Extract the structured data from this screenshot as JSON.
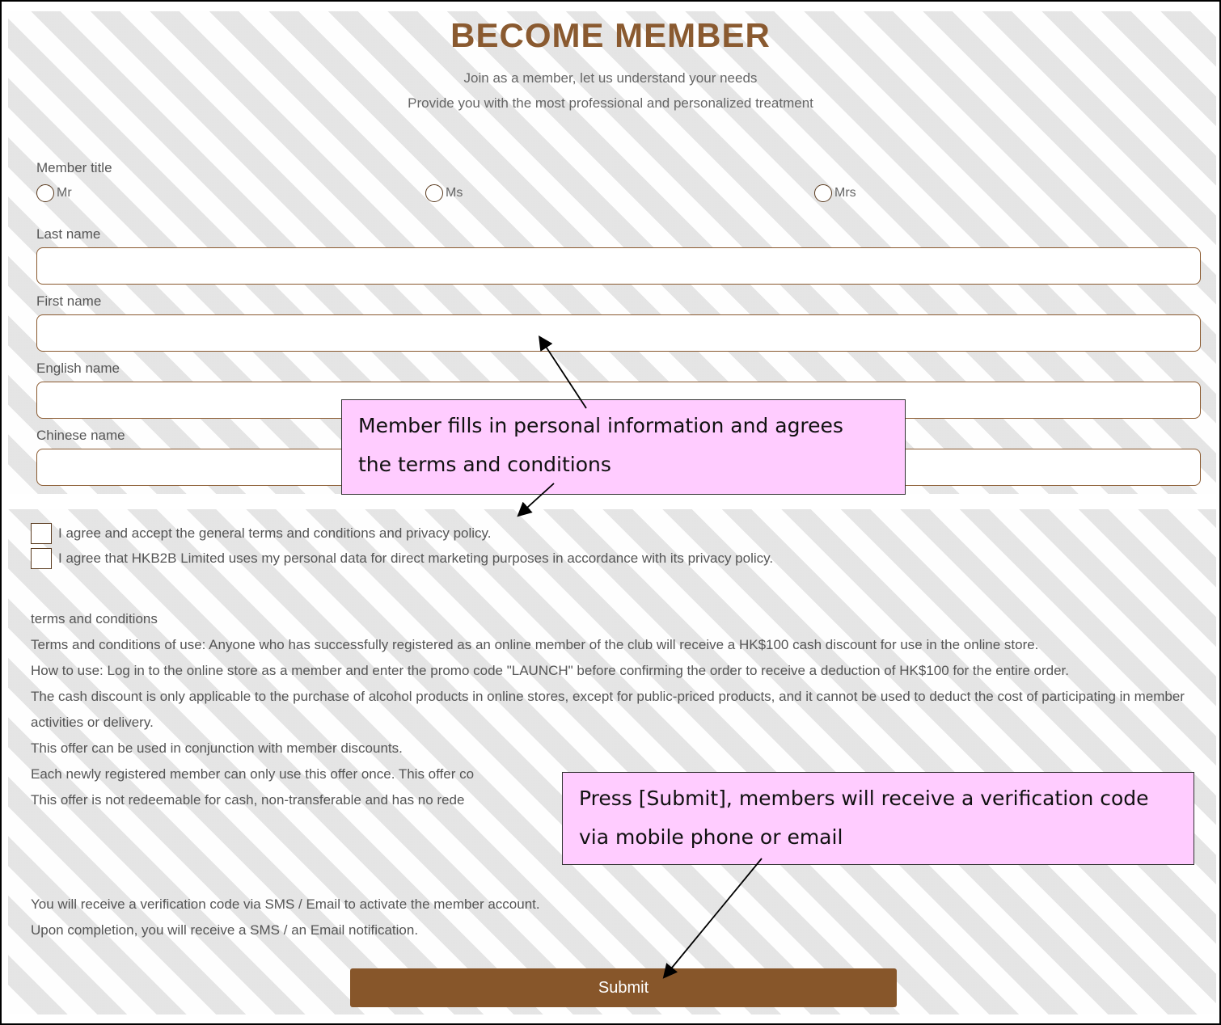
{
  "header": {
    "title": "BECOME MEMBER",
    "subtitle_line1": "Join as a member, let us understand your needs",
    "subtitle_line2": "Provide you with the most professional and personalized treatment"
  },
  "form": {
    "member_title_label": "Member title",
    "title_options": [
      "Mr",
      "Ms",
      "Mrs"
    ],
    "last_name_label": "Last name",
    "first_name_label": "First name",
    "english_name_label": "English name",
    "chinese_name_label": "Chinese name",
    "last_name_value": "",
    "first_name_value": "",
    "english_name_value": "",
    "chinese_name_value": ""
  },
  "agreements": {
    "terms_checkbox": "I agree and accept the general terms and conditions and privacy policy.",
    "marketing_checkbox": "I agree that HKB2B Limited uses my personal data for direct marketing purposes in accordance with its privacy policy."
  },
  "terms": {
    "heading": "terms and conditions",
    "line1": "Terms and conditions of use: Anyone who has successfully registered as an online member of the club will receive a HK$100 cash discount for use in the online store.",
    "line2": "How to use: Log in to the online store as a member and enter the promo code \"LAUNCH\" before confirming the order to receive a deduction of HK$100 for the entire order.",
    "line3": "The cash discount is only applicable to the purchase of alcohol products in online stores, except for public-priced products, and it cannot be used to deduct the cost of participating in member activities or delivery.",
    "line4": "This offer can be used in conjunction with member discounts.",
    "line5": "Each newly registered member can only use this offer once. This offer co",
    "line6": "This offer is not redeemable for cash, non-transferable and has no rede"
  },
  "verification": {
    "line1": "You will receive a verification code via SMS / Email to activate the member account.",
    "line2": "Upon completion, you will receive a SMS / an Email notification."
  },
  "submit_label": "Submit",
  "annotations": {
    "callout1_line1": "Member fills in personal information and agrees",
    "callout1_line2": "the terms and conditions",
    "callout2_line1": "Press [Submit], members will receive a verification code",
    "callout2_line2": "via mobile phone or email"
  },
  "colors": {
    "brand": "#8a5a30",
    "submit_bg": "#87562a",
    "callout_bg": "#ffccff"
  }
}
